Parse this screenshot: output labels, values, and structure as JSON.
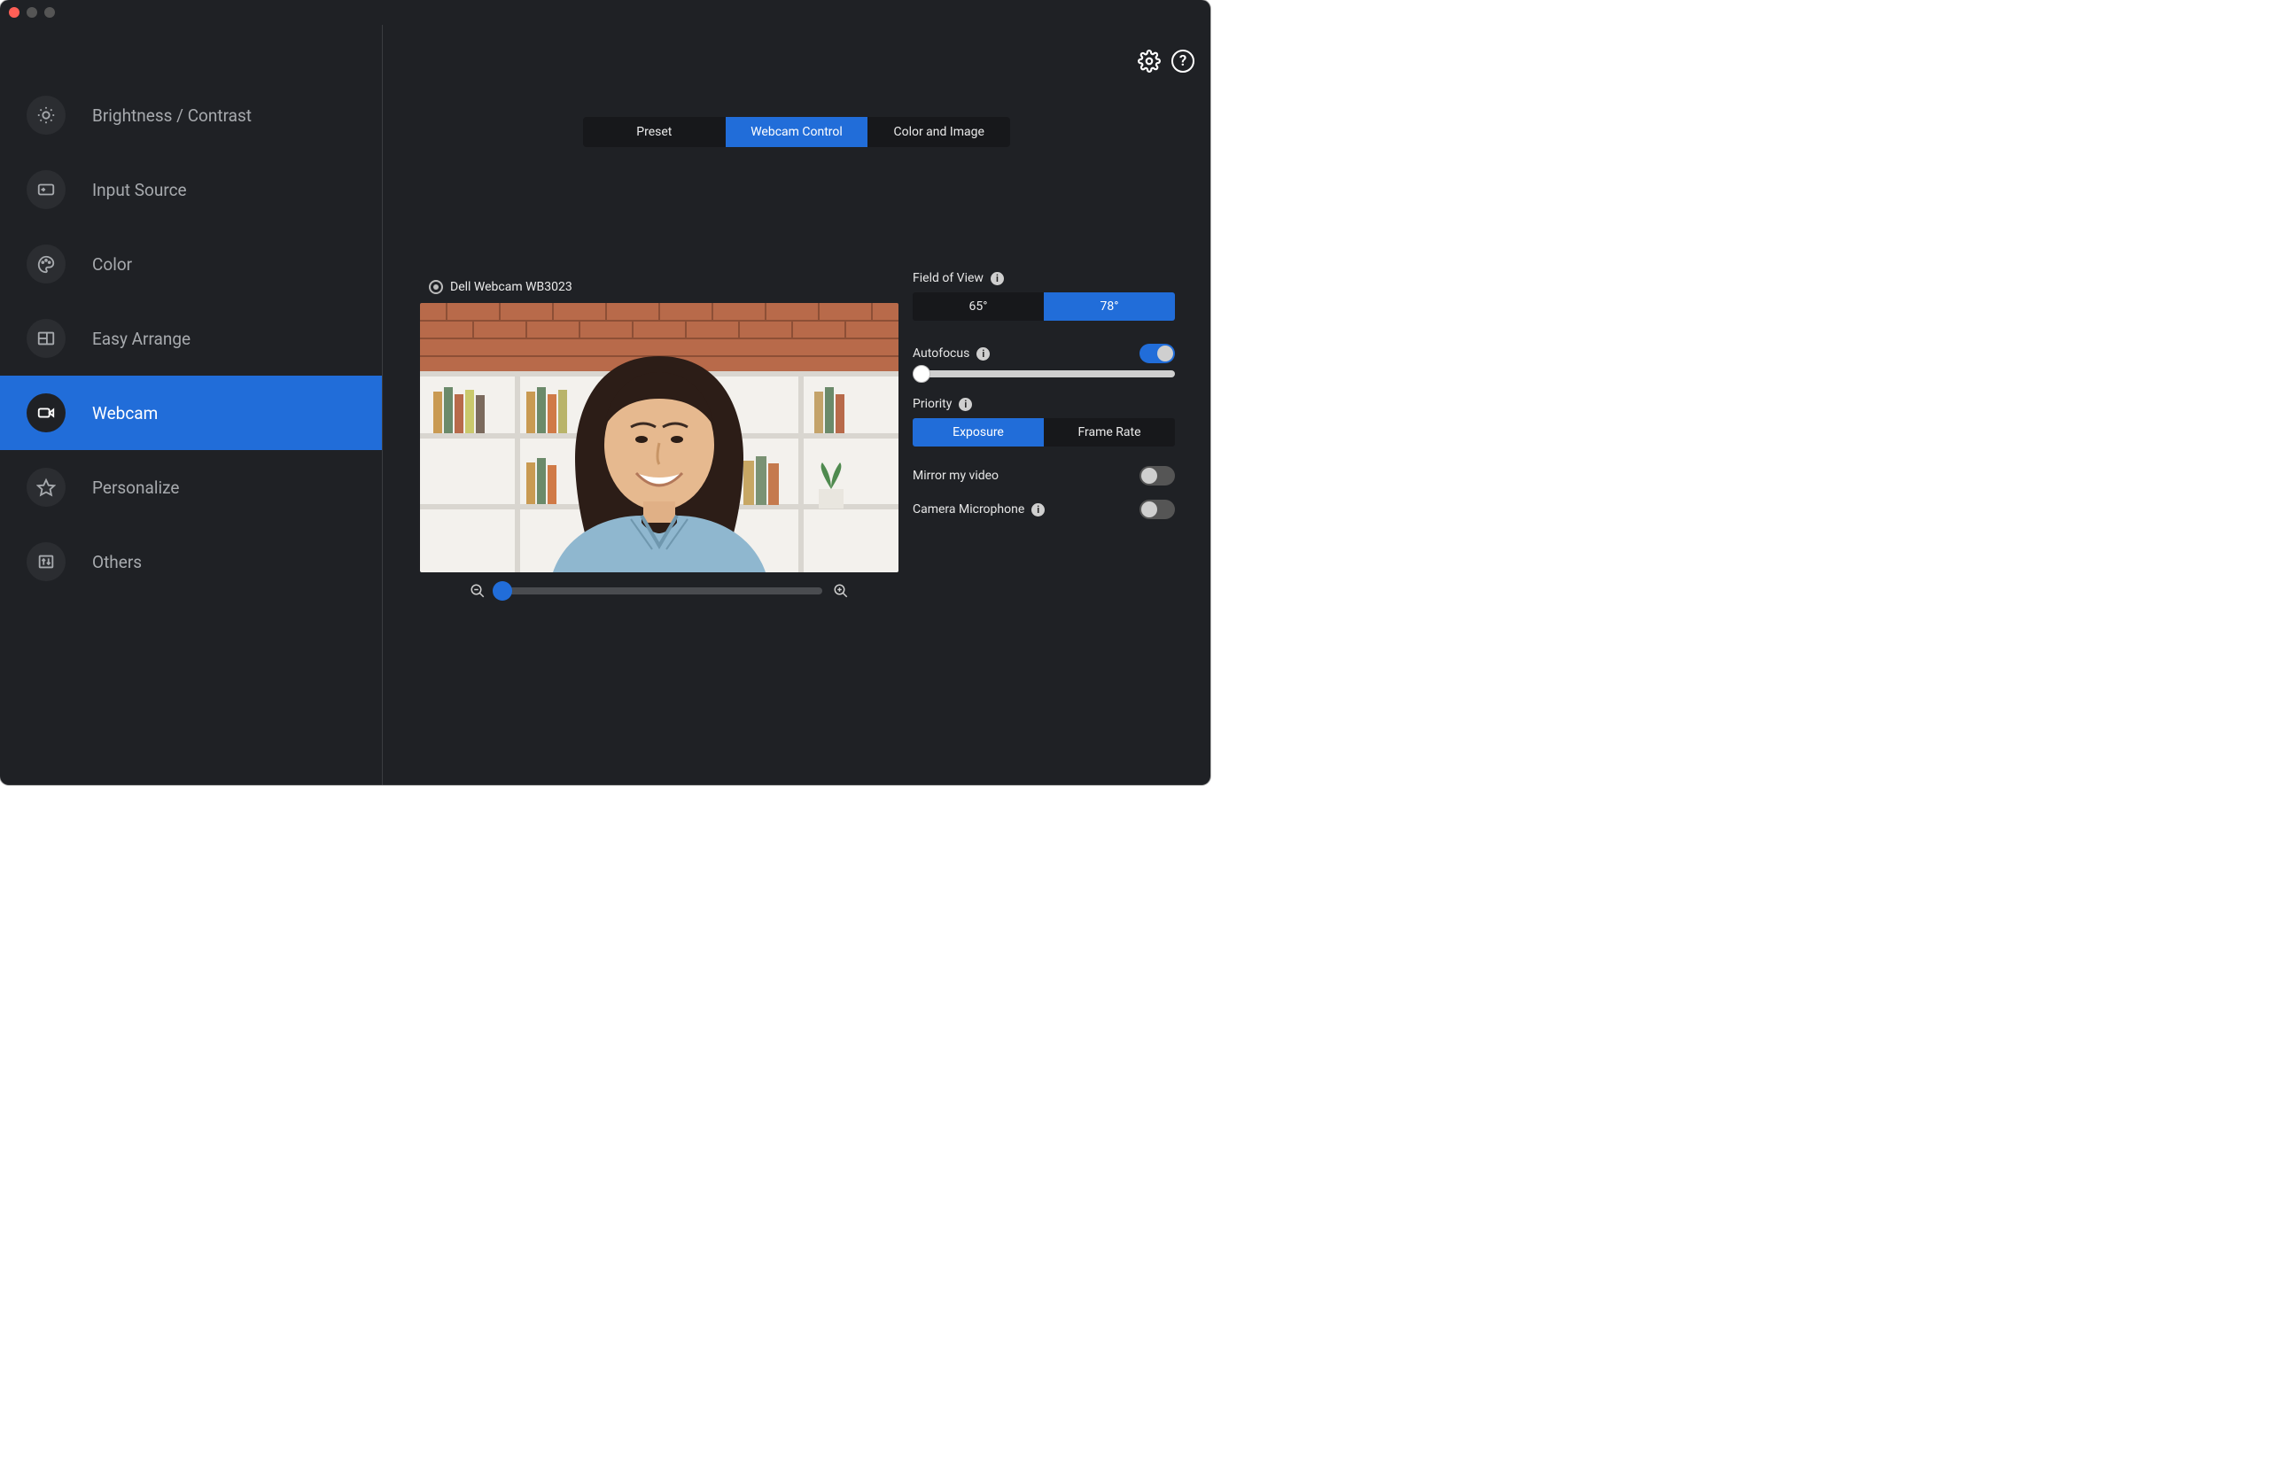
{
  "sidebar": {
    "items": [
      {
        "label": "Brightness / Contrast",
        "icon": "brightness-icon",
        "active": false
      },
      {
        "label": "Input Source",
        "icon": "input-source-icon",
        "active": false
      },
      {
        "label": "Color",
        "icon": "color-icon",
        "active": false
      },
      {
        "label": "Easy Arrange",
        "icon": "easy-arrange-icon",
        "active": false
      },
      {
        "label": "Webcam",
        "icon": "webcam-icon",
        "active": true
      },
      {
        "label": "Personalize",
        "icon": "personalize-icon",
        "active": false
      },
      {
        "label": "Others",
        "icon": "others-icon",
        "active": false
      }
    ]
  },
  "tabs": {
    "items": [
      {
        "label": "Preset",
        "active": false
      },
      {
        "label": "Webcam Control",
        "active": true
      },
      {
        "label": "Color and Image",
        "active": false
      }
    ]
  },
  "device_name": "Dell Webcam WB3023",
  "controls": {
    "fov": {
      "label": "Field of View",
      "options": [
        "65°",
        "78°"
      ],
      "active_index": 1
    },
    "autofocus": {
      "label": "Autofocus",
      "on": true,
      "slider_percent": 0
    },
    "priority": {
      "label": "Priority",
      "options": [
        "Exposure",
        "Frame Rate"
      ],
      "active_index": 0
    },
    "mirror": {
      "label": "Mirror my video",
      "on": false
    },
    "camera_mic": {
      "label": "Camera Microphone",
      "on": false
    }
  },
  "zoom_percent": 0,
  "header": {
    "settings": "settings-icon",
    "help_glyph": "?"
  }
}
